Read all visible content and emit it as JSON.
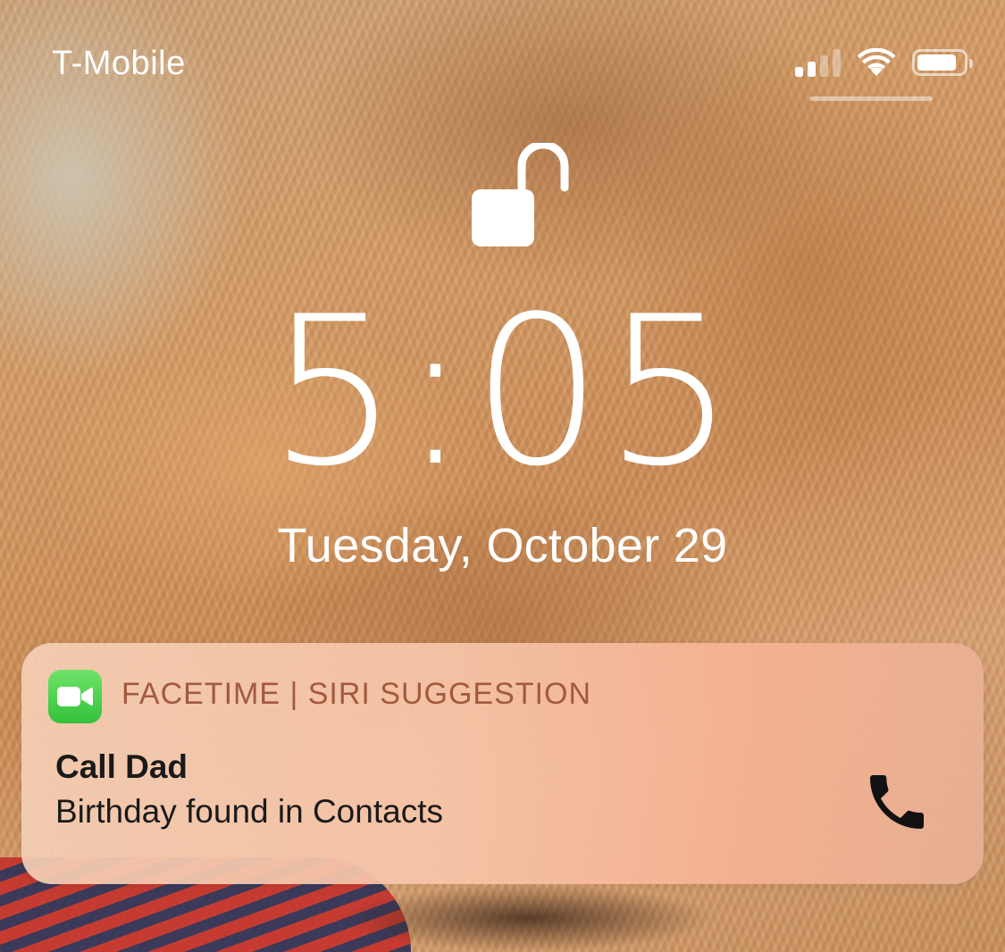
{
  "status_bar": {
    "carrier": "T-Mobile",
    "signal_bars_filled": 2,
    "signal_bars_total": 4,
    "wifi_icon": "wifi-icon",
    "battery_level": 0.85
  },
  "lock_screen": {
    "lock_icon": "unlocked-padlock-icon",
    "time": "5:05",
    "date": "Tuesday, October 29"
  },
  "notification": {
    "app_icon": "facetime-icon",
    "app_name": "FACETIME | SIRI SUGGESTION",
    "title": "Call Dad",
    "body": "Birthday found in Contacts",
    "action_icon": "phone-icon"
  },
  "colors": {
    "text_primary": "#ffffff",
    "notification_app_name": "#a15a3f",
    "facetime_green": "#33c23a"
  }
}
